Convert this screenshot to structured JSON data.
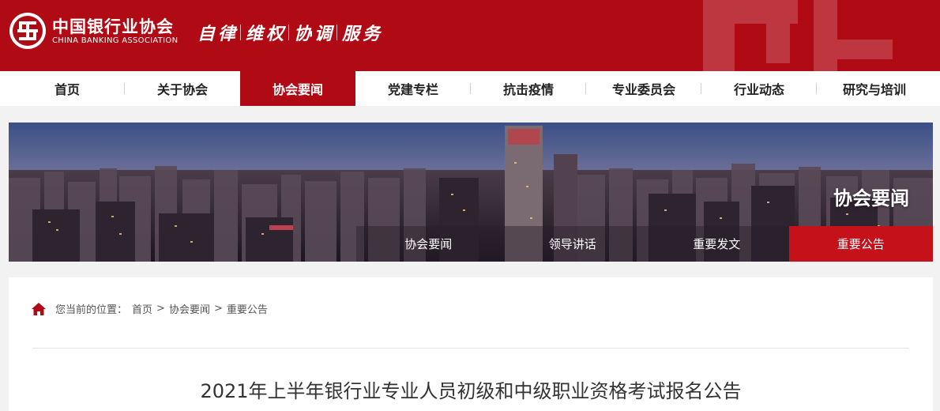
{
  "header": {
    "org_name_cn": "中国银行业协会",
    "org_name_en": "CHINA BANKING ASSOCIATION",
    "slogan": [
      "自律",
      "维权",
      "协调",
      "服务"
    ],
    "brand_color": "#b00a14"
  },
  "nav": {
    "items": [
      {
        "label": "首页"
      },
      {
        "label": "关于协会"
      },
      {
        "label": "协会要闻",
        "active": true
      },
      {
        "label": "党建专栏"
      },
      {
        "label": "抗击疫情"
      },
      {
        "label": "专业委员会"
      },
      {
        "label": "行业动态"
      },
      {
        "label": "研究与培训"
      }
    ]
  },
  "banner": {
    "title": "协会要闻",
    "subnav": [
      {
        "label": "协会要闻"
      },
      {
        "label": "领导讲话"
      },
      {
        "label": "重要发文"
      },
      {
        "label": "重要公告",
        "active": true
      }
    ]
  },
  "breadcrumb": {
    "prefix": "您当前的位置：",
    "items": [
      "首页",
      "协会要闻",
      "重要公告"
    ],
    "separator": ">"
  },
  "article": {
    "title": "2021年上半年银行业专业人员初级和中级职业资格考试报名公告"
  }
}
